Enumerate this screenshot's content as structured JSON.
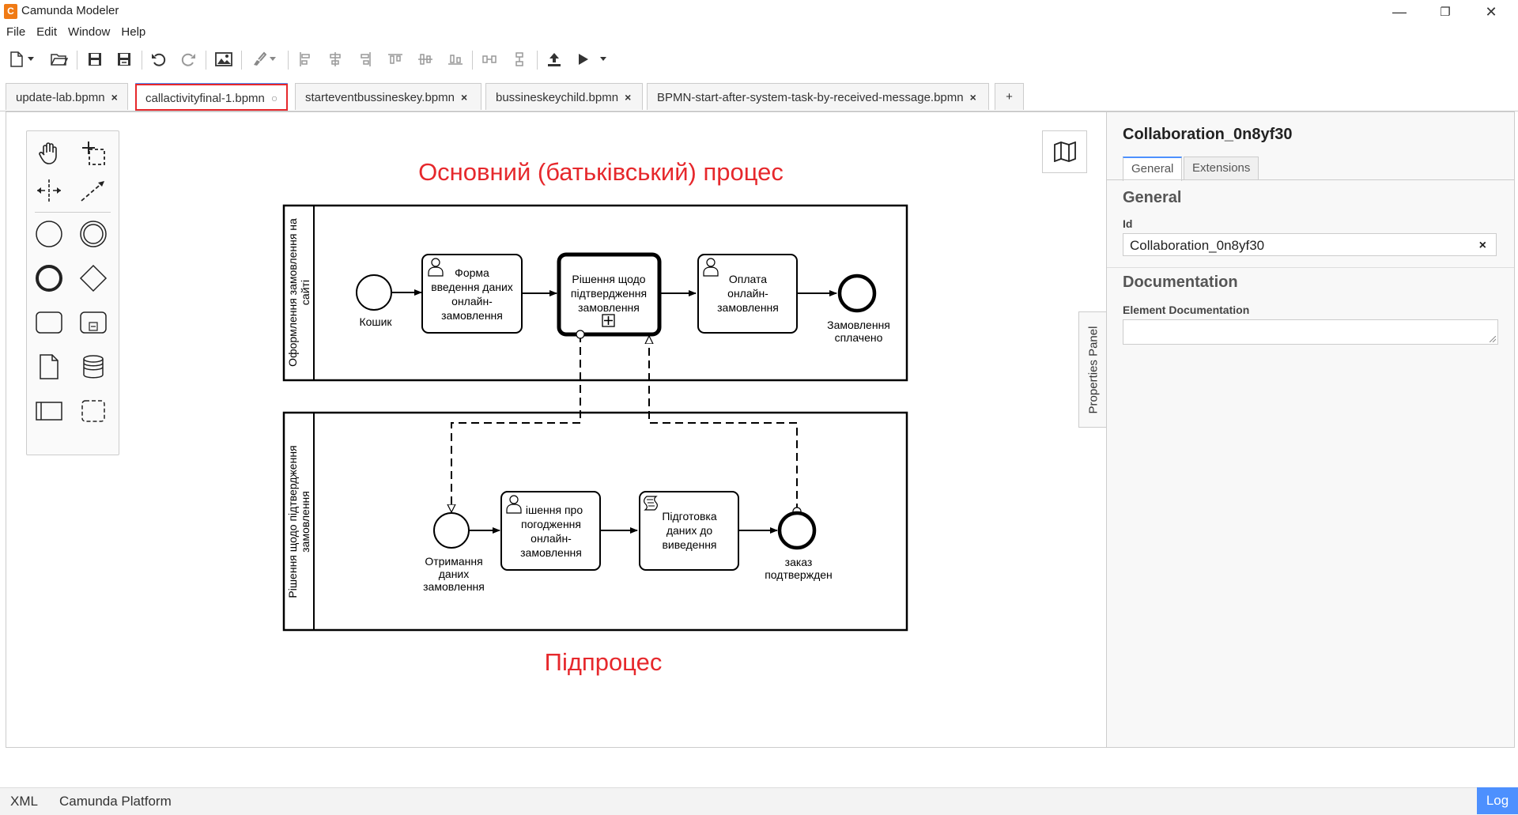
{
  "window": {
    "logo_letter": "C",
    "title": "Camunda Modeler",
    "minimize": "—",
    "restore": "❐",
    "close": "✕"
  },
  "menu": [
    "File",
    "Edit",
    "Window",
    "Help"
  ],
  "tabs": [
    {
      "label": "update-lab.bpmn",
      "close": "×",
      "active": false
    },
    {
      "label": "callactivityfinal-1.bpmn",
      "close": "○",
      "active": true
    },
    {
      "label": "starteventbussineskey.bpmn",
      "close": "×",
      "active": false
    },
    {
      "label": "bussineskeychild.bpmn",
      "close": "×",
      "active": false
    },
    {
      "label": "BPMN-start-after-system-task-by-received-message.bpmn",
      "close": "×",
      "active": false
    }
  ],
  "new_tab": "+",
  "diagram": {
    "title_top": "Основний (батьківський) процес",
    "title_bottom": "Підпроцес",
    "pool1_label_line1": "Оформлення замовлення на",
    "pool1_label_line2": "сайті",
    "pool2_label_line1": "Рішення щодо підтвердження",
    "pool2_label_line2": "замовлення",
    "p1_start": "Кошик",
    "p1_task1": [
      "Форма",
      "введення даних",
      "онлайн-",
      "замовлення"
    ],
    "p1_task2": [
      "Рішення щодо",
      "підтвердження",
      "замовлення"
    ],
    "p1_task3": [
      "Оплата",
      "онлайн-",
      "замовлення"
    ],
    "p1_end": [
      "Замовлення",
      "сплачено"
    ],
    "p2_start": [
      "Отримання",
      "даних",
      "замовлення"
    ],
    "p2_task1": [
      "ішення про",
      "погодження",
      "онлайн-",
      "замовлення"
    ],
    "p2_task2": [
      "Підготовка",
      "даних до",
      "виведення"
    ],
    "p2_end": [
      "заказ",
      "подтвержден"
    ],
    "colors": {
      "annotation": "#e6282c",
      "stroke": "#000000"
    }
  },
  "properties": {
    "toggle_label": "Properties Panel",
    "title": "Collaboration_0n8yf30",
    "tab_general": "General",
    "tab_extensions": "Extensions",
    "section_general": "General",
    "id_label": "Id",
    "id_value": "Collaboration_0n8yf30",
    "id_clear": "×",
    "section_documentation": "Documentation",
    "doc_label": "Element Documentation"
  },
  "status": {
    "xml": "XML",
    "platform": "Camunda Platform",
    "log": "Log"
  }
}
